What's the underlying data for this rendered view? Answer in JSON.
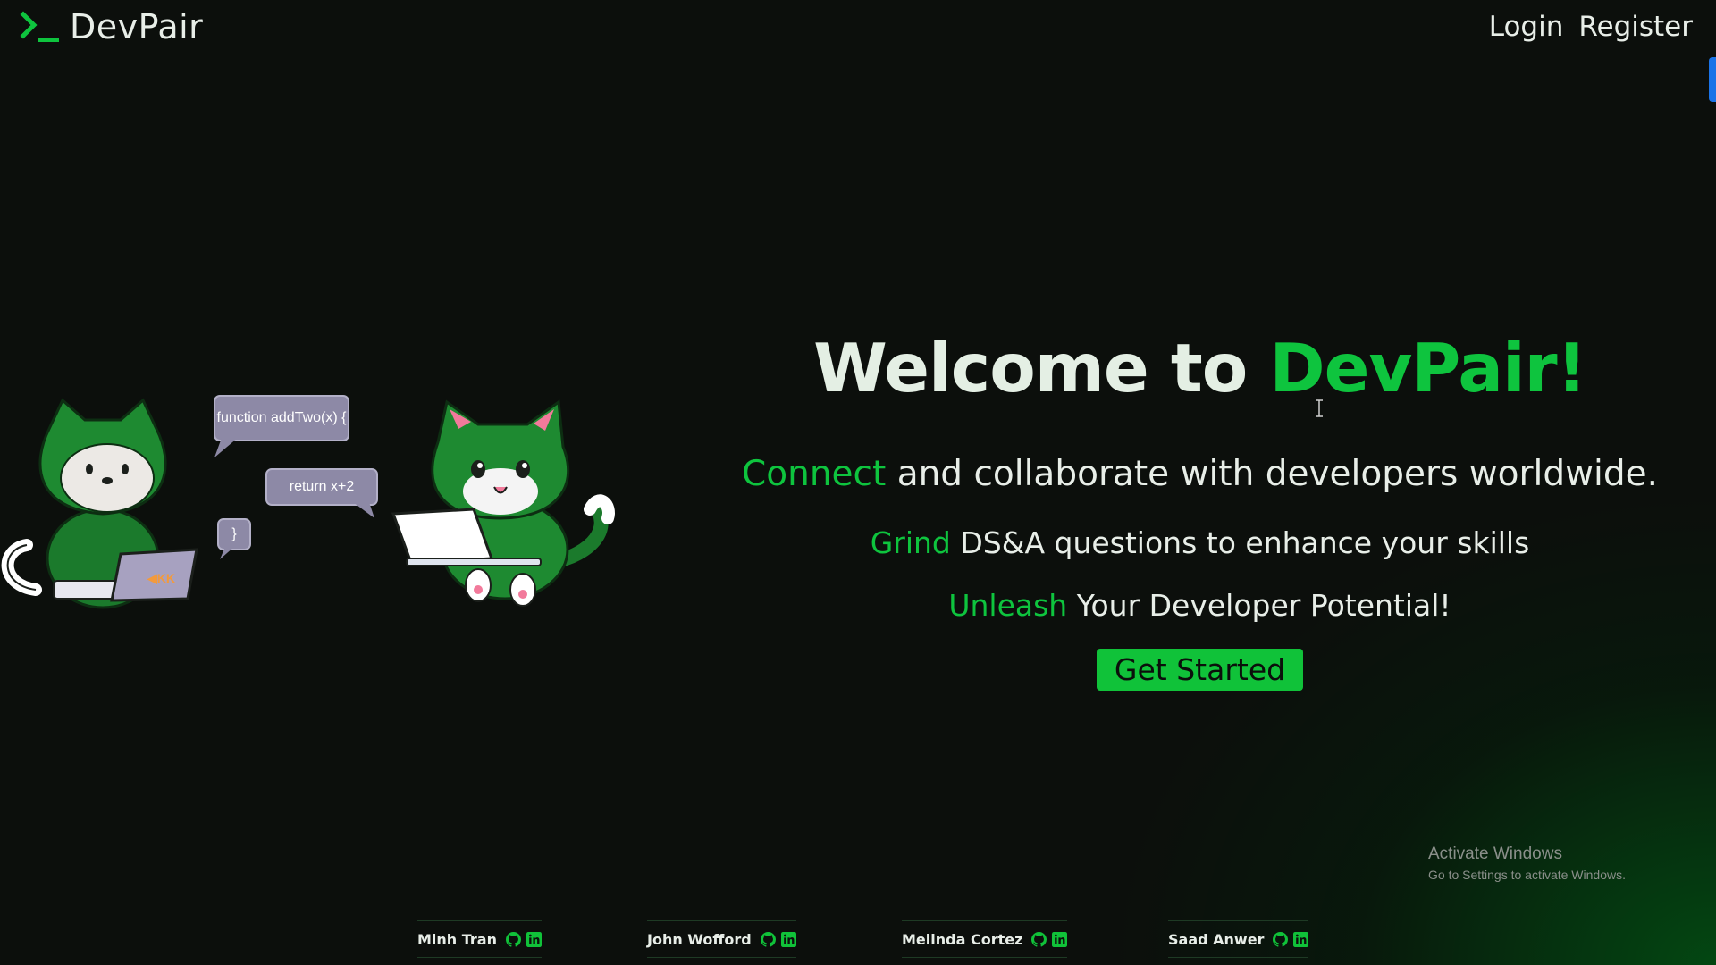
{
  "header": {
    "logo_text": "DevPair",
    "nav": {
      "login": "Login",
      "register": "Register"
    }
  },
  "illustration": {
    "bubbles": [
      "function addTwo(x) {",
      "return x+2",
      "}"
    ]
  },
  "hero": {
    "title_prefix": "Welcome to",
    "title_brand": "DevPair!",
    "tagline1_accent": "Connect",
    "tagline1_rest": "and collaborate with developers worldwide.",
    "tagline2_accent": "Grind",
    "tagline2_rest": "DS&A questions to enhance your skills",
    "tagline3_accent": "Unleash",
    "tagline3_rest": "Your Developer Potential!",
    "cta_label": "Get Started"
  },
  "watermark": {
    "title": "Activate Windows",
    "subtitle": "Go to Settings to activate Windows."
  },
  "team": [
    {
      "name": "Minh Tran"
    },
    {
      "name": "John Wofford"
    },
    {
      "name": "Melinda Cortez"
    },
    {
      "name": "Saad Anwer"
    }
  ],
  "colors": {
    "accent": "#0ec43e",
    "background": "#0c0f0c",
    "button": "#10c239"
  },
  "icons": [
    "terminal-logo-icon",
    "github-icon",
    "linkedin-icon",
    "text-cursor-icon"
  ]
}
